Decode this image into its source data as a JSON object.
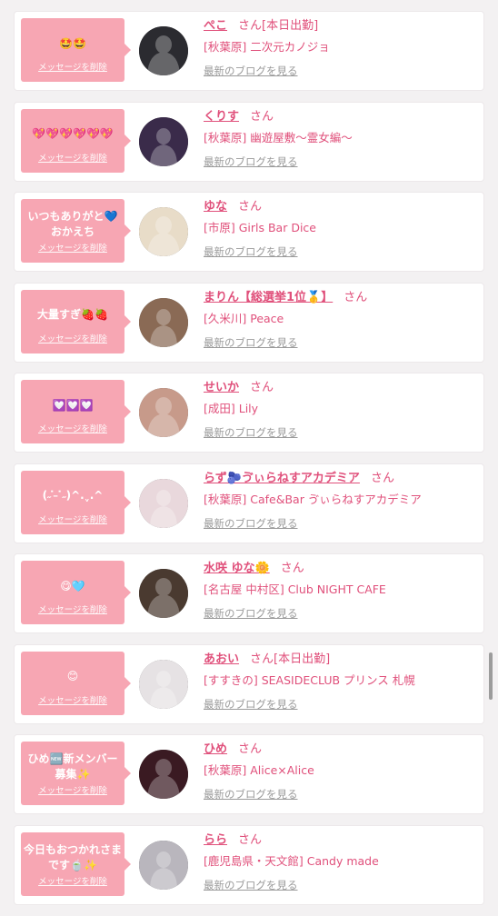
{
  "delete_label": "メッセージを削除",
  "blog_label": "最新のブログを見る",
  "honorific": "さん",
  "colors": {
    "accent": "#e0507b",
    "bubble": "#f7a6b3",
    "link_gray": "#9a9a9a"
  },
  "entries": [
    {
      "message": "🤩🤩",
      "name": "ぺこ",
      "status": "[本日出勤]",
      "shop": "[秋葉原] 二次元カノジョ",
      "avatar_color": "#2b2b30"
    },
    {
      "message": "💖💖💖💖💖💖",
      "name": "くりす",
      "status": "",
      "shop": "[秋葉原] 幽遊屋敷～霊女編～",
      "avatar_color": "#3a2b4a"
    },
    {
      "message": "いつもありがと💙おかえち",
      "name": "ゆな",
      "status": "",
      "shop": "[市原] Girls Bar Dice",
      "avatar_color": "#e8dcc8"
    },
    {
      "message": "大量すぎ🍓🍓",
      "name": "まりん【総選挙1位🥇】",
      "status": "",
      "shop": "[久米川] Peace",
      "avatar_color": "#8a6a55"
    },
    {
      "message": "💟💟💟",
      "name": "せいか",
      "status": "",
      "shop": "[成田] Lily",
      "avatar_color": "#c79a8a"
    },
    {
      "message": "(˶ ̇ ̵ ̇˶)^.ˬ.^",
      "name": "らず🫐ゔぃらねすアカデミア",
      "status": "",
      "shop": "[秋葉原] Cafe&Bar ゔぃらねすアカデミア",
      "avatar_color": "#e9d8dc"
    },
    {
      "message": "😋🩵",
      "name": "水咲 ゆな🌼",
      "status": "",
      "shop": "[名古屋 中村区] Club NIGHT CAFE",
      "avatar_color": "#4a3a30"
    },
    {
      "message": "😊",
      "name": "あおい",
      "status": "[本日出勤]",
      "shop": "[すすきの] SEASIDECLUB プリンス 札幌",
      "avatar_color": "#e6e2e4"
    },
    {
      "message": "ひめ🆕新メンバー募集✨",
      "name": "ひめ",
      "status": "",
      "shop": "[秋葉原] Alice×Alice",
      "avatar_color": "#3a1a22"
    },
    {
      "message": "今日もおつかれさまです🍵✨",
      "name": "らら",
      "status": "",
      "shop": "[鹿児島県・天文館] Candy made",
      "avatar_color": "#b9b6bd"
    }
  ]
}
